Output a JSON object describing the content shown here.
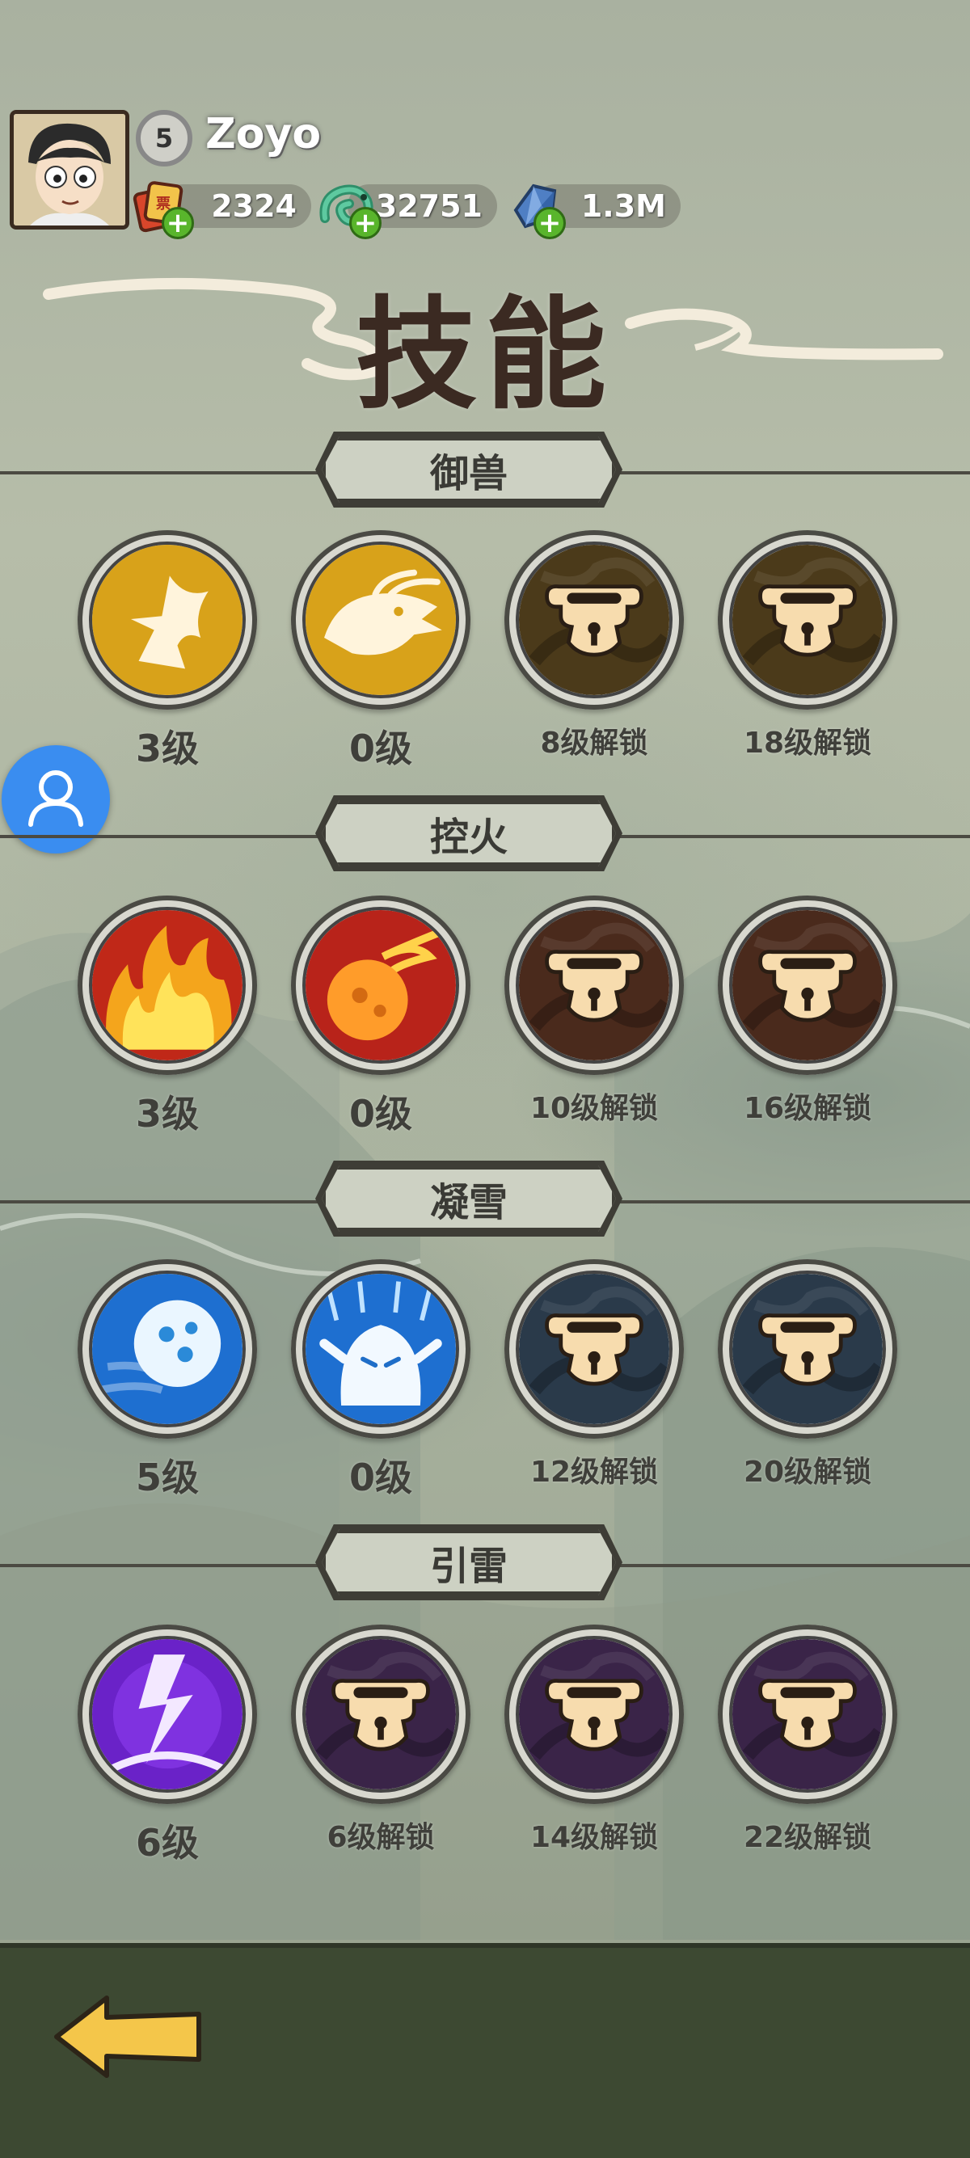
{
  "player": {
    "level": "5",
    "name": "Zoyo"
  },
  "currencies": [
    {
      "icon": "lucky-envelope-icon",
      "value": "2324"
    },
    {
      "icon": "jade-dragon-icon",
      "value": "32751"
    },
    {
      "icon": "blue-crystal-icon",
      "value": "1.3M"
    }
  ],
  "page_title": "技能",
  "sections": [
    {
      "title": "御兽",
      "skills": [
        {
          "icon": "eagle-icon",
          "label": "3级",
          "locked": false
        },
        {
          "icon": "dragon-head-icon",
          "label": "0级",
          "locked": false
        },
        {
          "icon": "lock-icon",
          "label": "8级解锁",
          "locked": true
        },
        {
          "icon": "lock-icon",
          "label": "18级解锁",
          "locked": true
        }
      ]
    },
    {
      "title": "控火",
      "skills": [
        {
          "icon": "flames-icon",
          "label": "3级",
          "locked": false
        },
        {
          "icon": "fireball-icon",
          "label": "0级",
          "locked": false
        },
        {
          "icon": "lock-icon",
          "label": "10级解锁",
          "locked": true
        },
        {
          "icon": "lock-icon",
          "label": "16级解锁",
          "locked": true
        }
      ]
    },
    {
      "title": "凝雪",
      "skills": [
        {
          "icon": "snowball-icon",
          "label": "5级",
          "locked": false
        },
        {
          "icon": "snow-spirit-icon",
          "label": "0级",
          "locked": false
        },
        {
          "icon": "lock-icon",
          "label": "12级解锁",
          "locked": true
        },
        {
          "icon": "lock-icon",
          "label": "20级解锁",
          "locked": true
        }
      ]
    },
    {
      "title": "引雷",
      "skills": [
        {
          "icon": "lightning-icon",
          "label": "6级",
          "locked": false
        },
        {
          "icon": "lock-icon",
          "label": "6级解锁",
          "locked": true
        },
        {
          "icon": "lock-icon",
          "label": "14级解锁",
          "locked": true
        },
        {
          "icon": "lock-icon",
          "label": "22级解锁",
          "locked": true
        }
      ]
    }
  ],
  "colors": {
    "beast_gold": "#d8a21a",
    "fire_red": "#b8231a",
    "ice_blue": "#1e6fd0",
    "thunder_purple": "#6a22c8",
    "bottom_bar": "#3d4932",
    "back_arrow": "#f4c64a"
  }
}
